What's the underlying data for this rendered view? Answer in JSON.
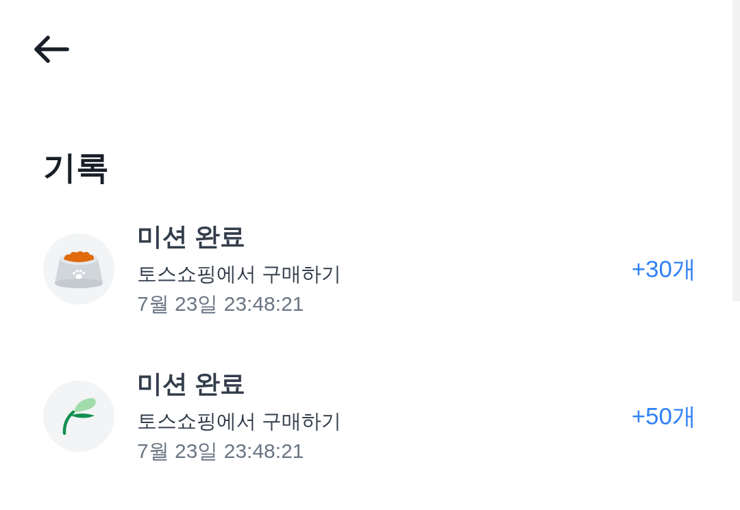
{
  "title": "기록",
  "records": [
    {
      "kind": "bowl",
      "title": "미션 완료",
      "description": "토스쇼핑에서 구매하기",
      "time": "7월 23일 23:48:21",
      "amount": "+30개"
    },
    {
      "kind": "plant",
      "title": "미션 완료",
      "description": "토스쇼핑에서 구매하기",
      "time": "7월 23일 23:48:21",
      "amount": "+50개"
    }
  ]
}
